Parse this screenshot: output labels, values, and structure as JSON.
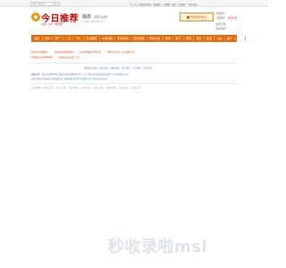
{
  "topbar": {
    "search_placeholder": "请输入搜索内容",
    "links": [
      "扫一扫",
      "免费发布信息",
      "我的推广",
      "免费推广服务",
      "置顶推广",
      "网站导航"
    ]
  },
  "header": {
    "logo_text": "今日推荐",
    "logo_slogan": "免费 · 高效 · 精准推广",
    "city_name": "临泉",
    "city_sub": "免费信息发布",
    "city_url": "linquan.365128.com"
  },
  "post_button": {
    "label": "免费发布信息"
  },
  "side_links": [
    {
      "label": "刷新推广",
      "value": ""
    },
    {
      "label": "顶置推广：",
      "value": "最佳位置"
    },
    {
      "label": "商务合作：",
      "value": ""
    },
    {
      "label": "联系电话：",
      "value": ""
    }
  ],
  "nav": {
    "items": [
      "首页",
      "招聘",
      "房产",
      "二手",
      "汽车",
      "生活服务",
      "车辆出租",
      "商务服务",
      "招商加盟",
      "同城公告",
      "宠物",
      "教育",
      "家居",
      "美食",
      "旅游",
      "交友",
      "推广",
      "工作"
    ]
  },
  "notices": [
    [
      "发布信息免费推广",
      "临泉信息网免费发布",
      "扫码查看更多本地信息",
      "本地生活信息一站式服务平台"
    ],
    [
      "免费发布信息随时随地",
      "同城信息发布推广平台"
    ]
  ],
  "center_links": [
    "免费发布信息",
    "信息分类",
    "网站地图",
    "用户协议",
    "关于我们",
    "联系我们"
  ],
  "info_lines": [
    {
      "label": "同城信息：",
      "text": "临泉信息网本地生活服务 临泉招聘求职 房产二手 车辆出租 同城交友信息推广 关注同城信息平台"
    },
    {
      "label": "",
      "text": "临泉信息网 免费发布 本地同城信息 便民服务 版权所有 备案信息 请勿发布违法信息"
    }
  ],
  "link_row": [
    "临泉招聘网",
    "临泉房产网",
    "临泉二手网",
    "临泉车辆网",
    "临泉服务网",
    "临泉生活网",
    "临泉便民网",
    "临泉交友网",
    "临泉推广网"
  ],
  "watermark": "秒收录啦msl"
}
